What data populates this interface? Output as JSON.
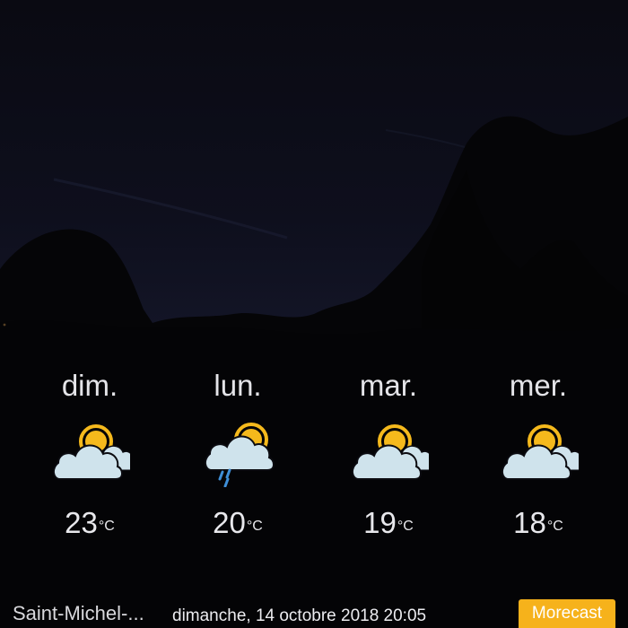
{
  "forecast": [
    {
      "day": "dim.",
      "temp": "23",
      "unit": "°C",
      "icon": "partly-cloudy-icon"
    },
    {
      "day": "lun.",
      "temp": "20",
      "unit": "°C",
      "icon": "rain-cloud-sun-icon"
    },
    {
      "day": "mar.",
      "temp": "19",
      "unit": "°C",
      "icon": "partly-cloudy-icon"
    },
    {
      "day": "mer.",
      "temp": "18",
      "unit": "°C",
      "icon": "partly-cloudy-icon"
    }
  ],
  "footer": {
    "location": "Saint-Michel-...",
    "datetime": "dimanche, 14 octobre 2018 20:05",
    "brand_button": "Morecast"
  },
  "colors": {
    "sun": "#f5b91c",
    "cloud": "#cfe3ec",
    "rain": "#3f8fd8",
    "brand": "#f6b21b"
  }
}
